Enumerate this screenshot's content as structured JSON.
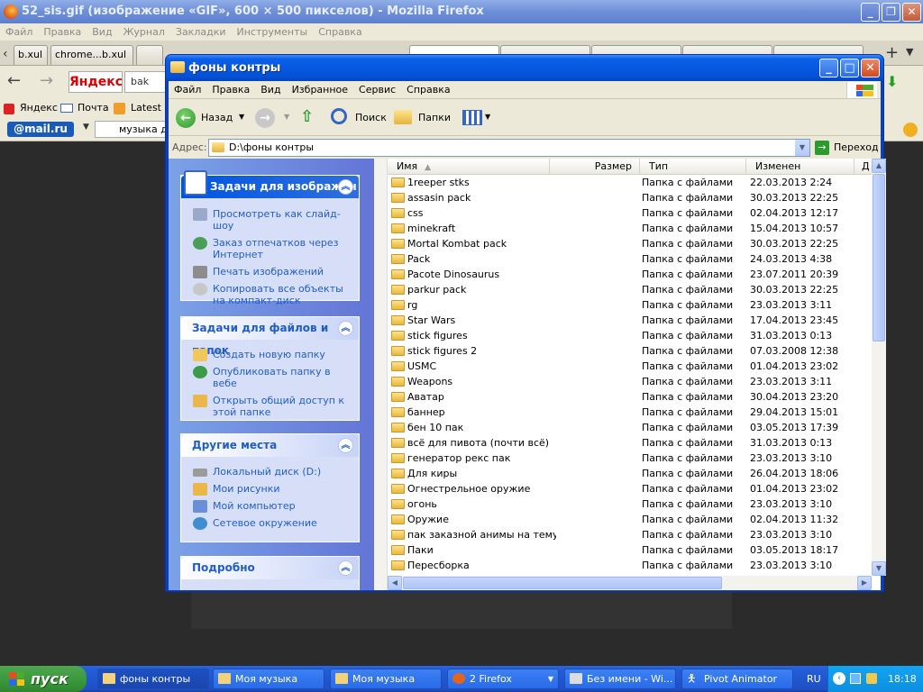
{
  "firefox": {
    "title": "52_sis.gif (изображение «GIF», 600 × 500 пикселов) - Mozilla Firefox",
    "menu": [
      "Файл",
      "Правка",
      "Вид",
      "Журнал",
      "Закладки",
      "Инструменты",
      "Справка"
    ],
    "tabs": [
      "b.xul",
      "chrome...b.xul"
    ],
    "search_engine": "Яндекс",
    "address_text": "bak",
    "bookmarks": [
      "Яндекс",
      "Почта",
      "Latest H"
    ],
    "mail_logo": "@mail.ru",
    "mail_search_text": "музыка д"
  },
  "explorer": {
    "title": "фоны контры",
    "menu": [
      "Файл",
      "Правка",
      "Вид",
      "Избранное",
      "Сервис",
      "Справка"
    ],
    "toolbar": {
      "back": "Назад",
      "search": "Поиск",
      "folders": "Папки"
    },
    "address_label": "Адрес:",
    "address_value": "D:\\фоны контры",
    "go_label": "Переход",
    "tasks": {
      "image_tasks": {
        "title": "Задачи для изображен",
        "items": [
          "Просмотреть как слайд-шоу",
          "Заказ отпечатков через Интернет",
          "Печать изображений",
          "Копировать все объекты на компакт-диск"
        ]
      },
      "file_tasks": {
        "title": "Задачи для файлов и папок",
        "items": [
          "Создать новую папку",
          "Опубликовать папку в вебе",
          "Открыть общий доступ к этой папке"
        ]
      },
      "other_places": {
        "title": "Другие места",
        "items": [
          "Локальный диск (D:)",
          "Мои рисунки",
          "Мой компьютер",
          "Сетевое окружение"
        ]
      },
      "details": {
        "title": "Подробно"
      }
    },
    "columns": {
      "name": "Имя",
      "size": "Размер",
      "type": "Тип",
      "modified": "Изменен",
      "extra": "Д"
    },
    "files": [
      {
        "name": "1reeper stks",
        "type": "Папка с файлами",
        "date": "22.03.2013 2:24"
      },
      {
        "name": "assasin pack",
        "type": "Папка с файлами",
        "date": "30.03.2013 22:25"
      },
      {
        "name": "css",
        "type": "Папка с файлами",
        "date": "02.04.2013 12:17"
      },
      {
        "name": "minekraft",
        "type": "Папка с файлами",
        "date": "15.04.2013 10:57"
      },
      {
        "name": "Mortal Kombat pack",
        "type": "Папка с файлами",
        "date": "30.03.2013 22:25"
      },
      {
        "name": "Pack",
        "type": "Папка с файлами",
        "date": "24.03.2013 4:38"
      },
      {
        "name": "Pacote Dinosaurus",
        "type": "Папка с файлами",
        "date": "23.07.2011 20:39"
      },
      {
        "name": "parkur pack",
        "type": "Папка с файлами",
        "date": "30.03.2013 22:25"
      },
      {
        "name": "rg",
        "type": "Папка с файлами",
        "date": "23.03.2013 3:11"
      },
      {
        "name": "Star Wars",
        "type": "Папка с файлами",
        "date": "17.04.2013 23:45"
      },
      {
        "name": "stick figures",
        "type": "Папка с файлами",
        "date": "31.03.2013 0:13"
      },
      {
        "name": "stick figures 2",
        "type": "Папка с файлами",
        "date": "07.03.2008 12:38"
      },
      {
        "name": "USMC",
        "type": "Папка с файлами",
        "date": "01.04.2013 23:02"
      },
      {
        "name": "Weapons",
        "type": "Папка с файлами",
        "date": "23.03.2013 3:11"
      },
      {
        "name": "Аватар",
        "type": "Папка с файлами",
        "date": "30.04.2013 23:20"
      },
      {
        "name": "баннер",
        "type": "Папка с файлами",
        "date": "29.04.2013 15:01"
      },
      {
        "name": "бен 10 пак",
        "type": "Папка с файлами",
        "date": "03.05.2013 17:39"
      },
      {
        "name": "всё для пивота (почти всё)",
        "type": "Папка с файлами",
        "date": "31.03.2013 0:13"
      },
      {
        "name": "генератор рекс пак",
        "type": "Папка с файлами",
        "date": "23.03.2013 3:10"
      },
      {
        "name": "Для киры",
        "type": "Папка с файлами",
        "date": "26.04.2013 18:06"
      },
      {
        "name": "Огнестрельное оружие",
        "type": "Папка с файлами",
        "date": "01.04.2013 23:02"
      },
      {
        "name": "огонь",
        "type": "Папка с файлами",
        "date": "23.03.2013 3:10"
      },
      {
        "name": "Оружие",
        "type": "Папка с файлами",
        "date": "02.04.2013 11:32"
      },
      {
        "name": "пак заказной анимы на тему...",
        "type": "Папка с файлами",
        "date": "23.03.2013 3:10"
      },
      {
        "name": "Паки",
        "type": "Папка с файлами",
        "date": "03.05.2013 18:17"
      },
      {
        "name": "Пересборка",
        "type": "Папка с файлами",
        "date": "23.03.2013 3:10"
      }
    ]
  },
  "taskbar": {
    "start": "пуск",
    "items": [
      "фоны контры",
      "Моя музыка",
      "Моя музыка",
      "2 Firefox",
      "Без имени - Wi...",
      "Pivot Animator"
    ],
    "lang": "RU",
    "clock": "18:18"
  }
}
